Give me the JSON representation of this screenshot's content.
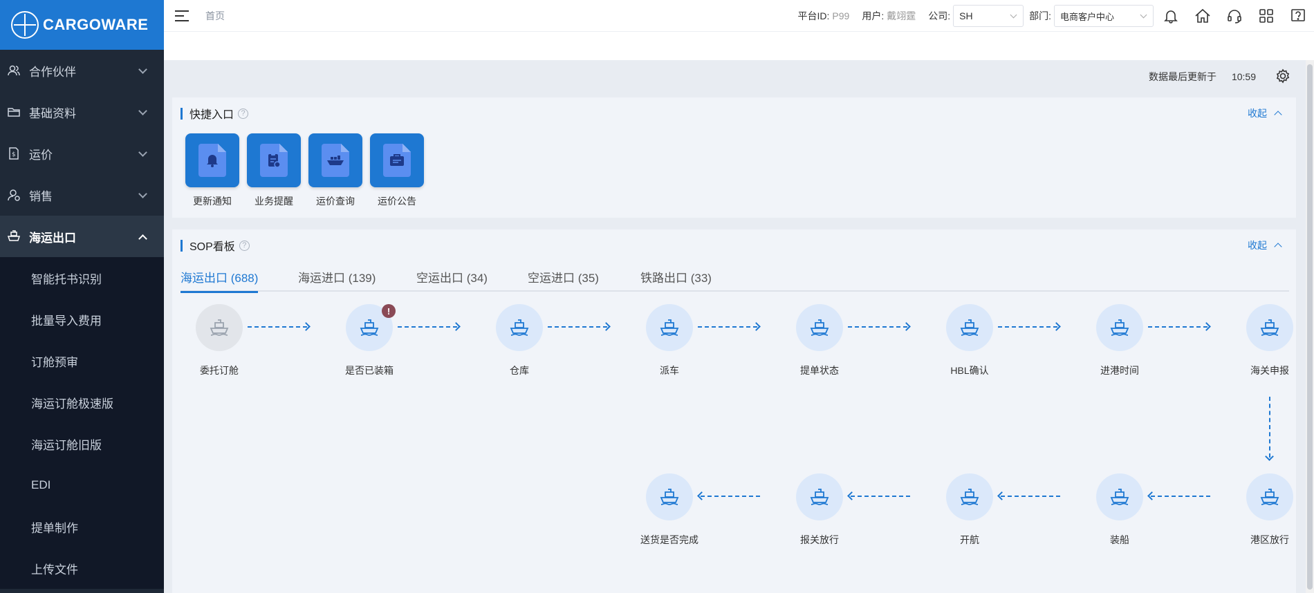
{
  "sidebar": {
    "brand": "CARGOWARE",
    "items": [
      {
        "label": "合作伙伴",
        "icon": "partners-icon"
      },
      {
        "label": "基础资料",
        "icon": "folder-icon"
      },
      {
        "label": "运价",
        "icon": "freight-rate-icon"
      },
      {
        "label": "销售",
        "icon": "sales-icon"
      },
      {
        "label": "海运出口",
        "icon": "ship-icon"
      }
    ],
    "sub_items": [
      "智能托书识别",
      "批量导入费用",
      "订舱预审",
      "海运订舱极速版",
      "海运订舱旧版",
      "EDI",
      "提单制作",
      "上传文件"
    ]
  },
  "header": {
    "breadcrumb": "首页",
    "platform_label": "平台ID:",
    "platform_value": "P99",
    "user_label": "用户:",
    "user_value": "戴翊霆",
    "company_label": "公司:",
    "company_value": "SH",
    "dept_label": "部门:",
    "dept_value": "电商客户中心",
    "icons": [
      "bell-icon",
      "home-icon",
      "headset-icon",
      "apps-grid-icon",
      "help-icon"
    ]
  },
  "main": {
    "update_label": "数据最后更新于",
    "update_time": "10:59"
  },
  "quick": {
    "title": "快捷入口",
    "collapse": "收起",
    "items": [
      {
        "label": "更新通知",
        "icon": "notice-icon"
      },
      {
        "label": "业务提醒",
        "icon": "reminder-icon"
      },
      {
        "label": "运价查询",
        "icon": "rate-query-icon"
      },
      {
        "label": "运价公告",
        "icon": "rate-announcement-icon"
      }
    ]
  },
  "sop": {
    "title": "SOP看板",
    "collapse": "收起",
    "tabs": [
      "海运出口 (688)",
      "海运进口 (139)",
      "空运出口 (34)",
      "空运进口 (35)",
      "铁路出口 (33)"
    ],
    "active_tab": 0,
    "row1": [
      "委托订舱",
      "是否已装箱",
      "仓库",
      "派车",
      "提单状态",
      "HBL确认",
      "进港时间",
      "海关申报"
    ],
    "row2": [
      "送货是否完成",
      "报关放行",
      "开航",
      "装船",
      "港区放行"
    ],
    "alert_badge": "!"
  },
  "colors": {
    "accent": "#1e78d2",
    "sidebar": "#1f2937",
    "badge": "#8a4a56"
  }
}
